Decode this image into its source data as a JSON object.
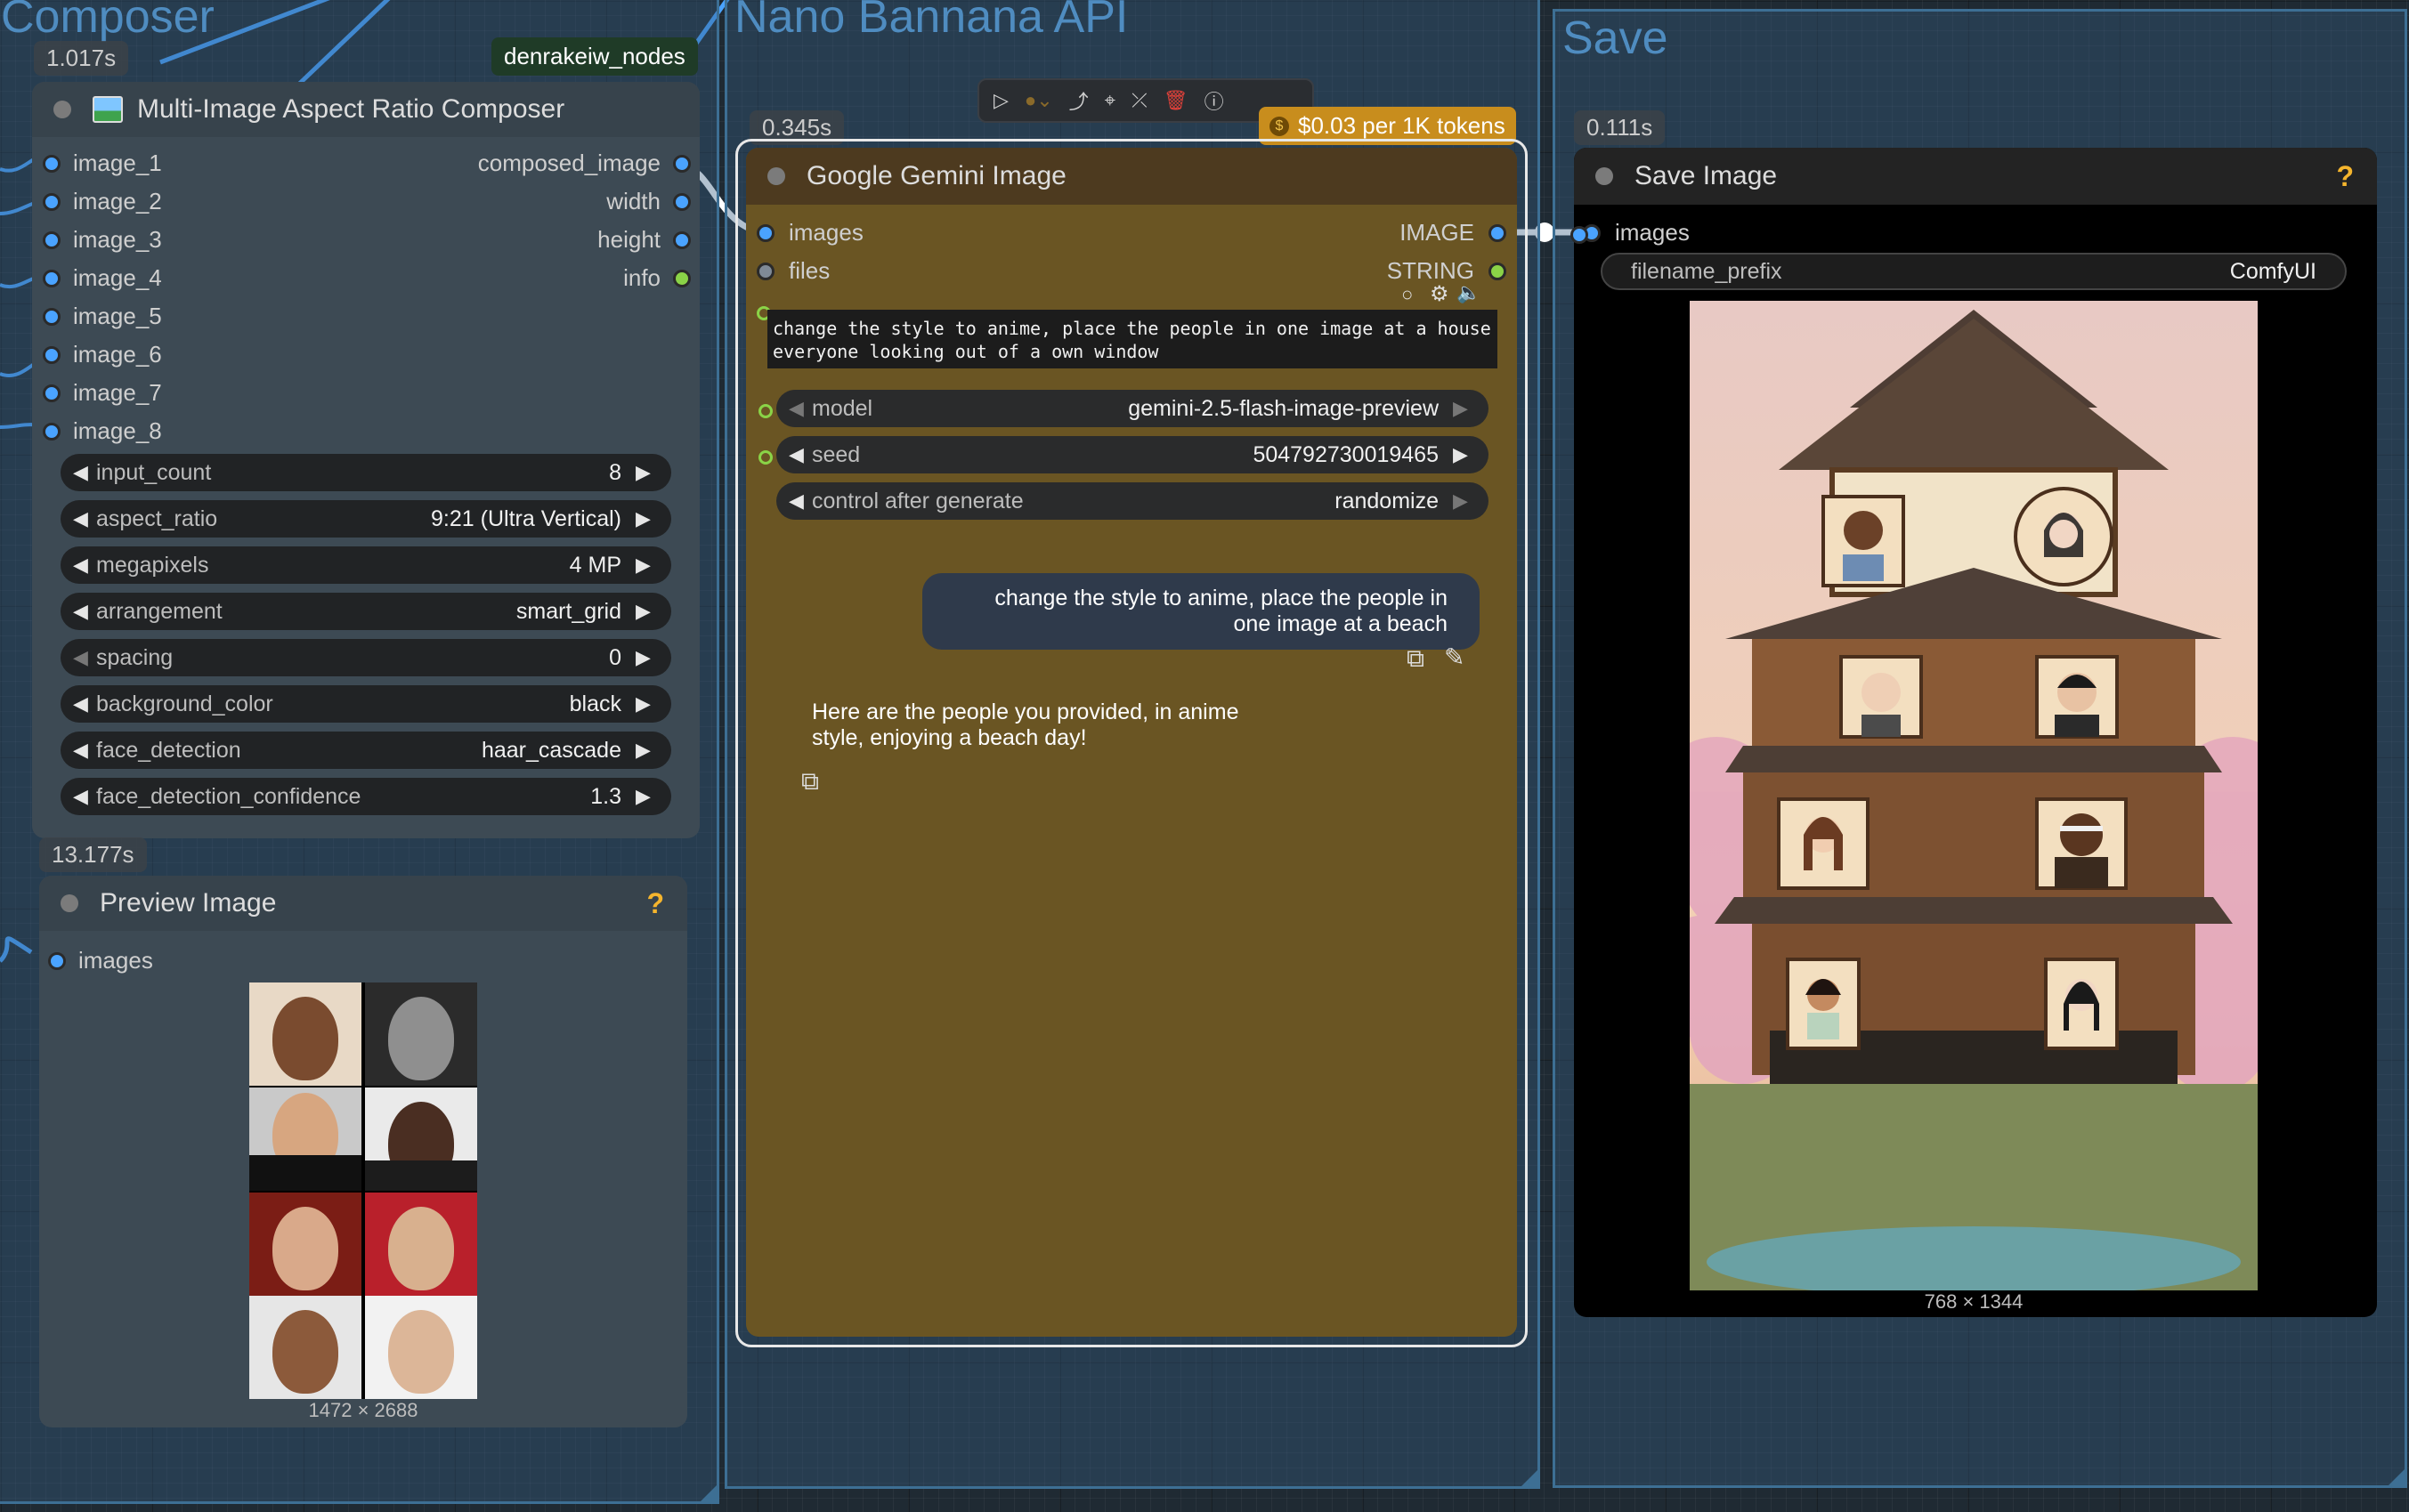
{
  "groups": {
    "composer": {
      "title": "Composer"
    },
    "nano": {
      "title": "Nano Bannana API"
    },
    "save": {
      "title": "Save"
    }
  },
  "timings": {
    "composer": "1.017s",
    "preview": "13.177s",
    "gemini": "0.345s",
    "save": "0.111s"
  },
  "composer_node": {
    "badge": "denrakeiw_nodes",
    "title": "Multi-Image Aspect Ratio Composer",
    "inputs": [
      "image_1",
      "image_2",
      "image_3",
      "image_4",
      "image_5",
      "image_6",
      "image_7",
      "image_8"
    ],
    "outputs": [
      "composed_image",
      "width",
      "height",
      "info"
    ],
    "widgets": [
      {
        "label": "input_count",
        "value": "8"
      },
      {
        "label": "aspect_ratio",
        "value": "9:21 (Ultra Vertical)"
      },
      {
        "label": "megapixels",
        "value": "4 MP"
      },
      {
        "label": "arrangement",
        "value": "smart_grid"
      },
      {
        "label": "spacing",
        "value": "0"
      },
      {
        "label": "background_color",
        "value": "black"
      },
      {
        "label": "face_detection",
        "value": "haar_cascade"
      },
      {
        "label": "face_detection_confidence",
        "value": "1.3"
      }
    ]
  },
  "preview_node": {
    "title": "Preview Image",
    "help": "?",
    "input": "images",
    "dimensions": "1472 × 2688"
  },
  "gemini_node": {
    "title": "Google Gemini Image",
    "price": "$0.03 per 1K tokens",
    "inputs": [
      "images",
      "files"
    ],
    "outputs": [
      "IMAGE",
      "STRING"
    ],
    "prompt": "change the style to anime, place the people in one image at a house everyone looking out of a own window",
    "widgets": [
      {
        "label": "model",
        "value": "gemini-2.5-flash-image-preview"
      },
      {
        "label": "seed",
        "value": "504792730019465"
      },
      {
        "label": "control after generate",
        "value": "randomize"
      }
    ],
    "chat_user": "change the style to anime, place the people in one image at a beach",
    "chat_reply": "Here are the people you provided, in anime style, enjoying a beach day!"
  },
  "save_node": {
    "title": "Save Image",
    "help": "?",
    "input": "images",
    "widget": {
      "label": "filename_prefix",
      "value": "ComfyUI"
    },
    "dimensions": "768 × 1344"
  },
  "colors": {
    "group_border": "#3d6f94",
    "group_title": "#4f8cc0",
    "node_dark": "#353535",
    "gemini_body": "#6a5523",
    "gemini_header": "#4d3a1f",
    "price_tag": "#c88d1d",
    "link_blue": "#4aa3ff"
  }
}
